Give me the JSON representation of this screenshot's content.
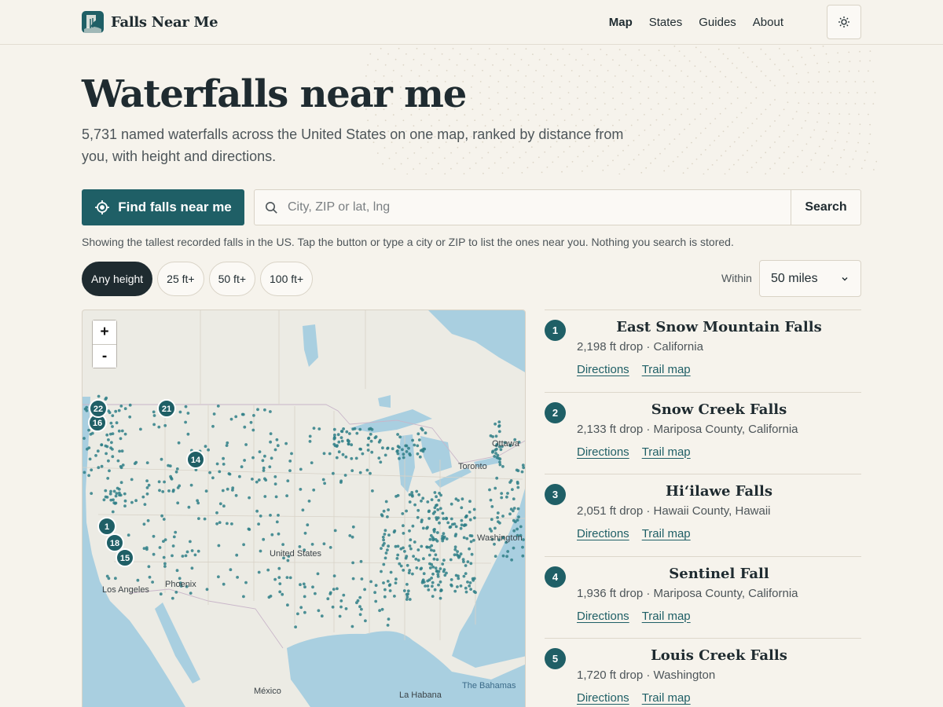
{
  "brand": {
    "name": "Falls Near Me",
    "logo_icon": "waterfall-logo-icon"
  },
  "nav": {
    "items": [
      "Map",
      "States",
      "Guides",
      "About"
    ],
    "active": "Map",
    "theme_toggle_icon": "sun-icon"
  },
  "hero": {
    "title": "Waterfalls near me",
    "subtitle": "5,731 named waterfalls across the United States on one map, ranked by distance from you, with height and directions."
  },
  "search": {
    "locate_label": "Find falls near me",
    "locate_icon": "crosshair-icon",
    "placeholder": "City, ZIP or lat, lng",
    "value": "",
    "button_label": "Search",
    "notice": "Showing the tallest recorded falls in the US. Tap the button or type a city or ZIP to list the ones near you. Nothing you search is stored."
  },
  "filters": {
    "height_options": [
      "Any height",
      "25 ft+",
      "50 ft+",
      "100 ft+"
    ],
    "active_height": "Any height",
    "within_label": "Within",
    "distance_value": "50 miles"
  },
  "map": {
    "zoom_in": "+",
    "zoom_out": "-",
    "place_labels": [
      "Ottawa",
      "Toronto",
      "Washington",
      "United States",
      "Phoenix",
      "Los Angeles",
      "México",
      "La Habana",
      "The Bahamas"
    ],
    "markers": [
      "21",
      "16",
      "22",
      "14",
      "1",
      "18",
      "15"
    ],
    "colors": {
      "water": "#a9cfe0",
      "land": "#ecebe4",
      "marker": "#1f5f66"
    }
  },
  "results": [
    {
      "rank": "1",
      "name": "East Snow Mountain Falls",
      "meta": "2,198 ft drop · California",
      "directions": "Directions",
      "trail": "Trail map"
    },
    {
      "rank": "2",
      "name": "Snow Creek Falls",
      "meta": "2,133 ft drop · Mariposa County, California",
      "directions": "Directions",
      "trail": "Trail map"
    },
    {
      "rank": "3",
      "name": "Hiʻilawe Falls",
      "meta": "2,051 ft drop · Hawaii County, Hawaii",
      "directions": "Directions",
      "trail": "Trail map"
    },
    {
      "rank": "4",
      "name": "Sentinel Fall",
      "meta": "1,936 ft drop · Mariposa County, California",
      "directions": "Directions",
      "trail": "Trail map"
    },
    {
      "rank": "5",
      "name": "Louis Creek Falls",
      "meta": "1,720 ft drop · Washington",
      "directions": "Directions",
      "trail": "Trail map"
    }
  ],
  "colors": {
    "accent": "#1f5f66",
    "ink": "#1f2b30",
    "background": "#f6f3ec"
  }
}
